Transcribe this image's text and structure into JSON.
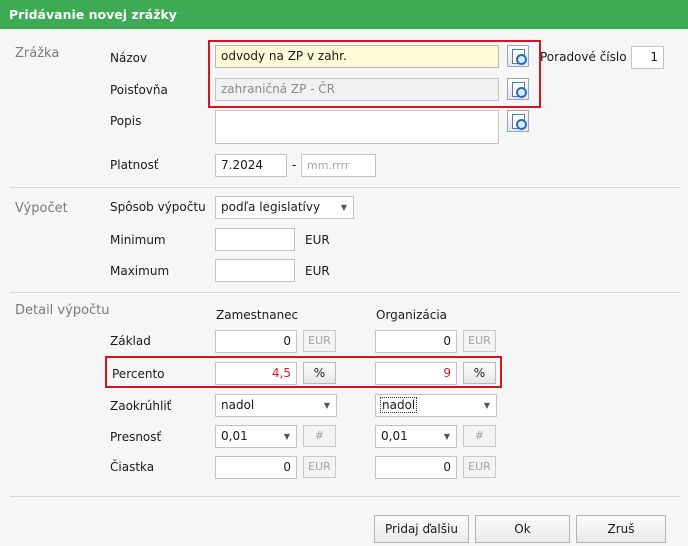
{
  "window": {
    "title": "Pridávanie novej zrážky"
  },
  "zrazka": {
    "section_label": "Zrážka",
    "nazov_label": "Názov",
    "nazov_value": "odvody na ZP v zahr.",
    "poistovna_label": "Poisťovňa",
    "poistovna_value": "zahraničná ZP - ČR",
    "popis_label": "Popis",
    "popis_value": "",
    "platnost_label": "Platnosť",
    "platnost_from": "7.2024",
    "platnost_dash": "-",
    "platnost_to_placeholder": "mm.rrrr",
    "poradove_label": "Poradové číslo",
    "poradove_value": "1"
  },
  "vypocet": {
    "section_label": "Výpočet",
    "sposob_label": "Spôsob výpočtu",
    "sposob_value": "podľa legislatívy",
    "minimum_label": "Minimum",
    "minimum_value": "",
    "minimum_unit": "EUR",
    "maximum_label": "Maximum",
    "maximum_value": "",
    "maximum_unit": "EUR"
  },
  "detail": {
    "section_label": "Detail výpočtu",
    "col_zamestnanec": "Zamestnanec",
    "col_organizacia": "Organizácia",
    "zaklad_label": "Základ",
    "zaklad_zam": "0",
    "zaklad_org": "0",
    "percento_label": "Percento",
    "percento_zam": "4,5",
    "percento_org": "9",
    "zaokruhlit_label": "Zaokrúhliť",
    "zaokruhlit_zam": "nadol",
    "zaokruhlit_org": "nadol",
    "presnost_label": "Presnosť",
    "presnost_zam": "0,01",
    "presnost_org": "0,01",
    "ciastka_label": "Čiastka",
    "ciastka_zam": "0",
    "ciastka_org": "0",
    "eur_unit": "EUR",
    "pct_unit": "%",
    "hash_unit": "#"
  },
  "footer": {
    "pridaj_label": "Pridaj ďalšiu",
    "ok_label": "Ok",
    "zrus_label": "Zruš"
  },
  "colors": {
    "title_bar": "#3daa54",
    "highlight_box": "#d3151d",
    "value_red": "#e0182a"
  }
}
